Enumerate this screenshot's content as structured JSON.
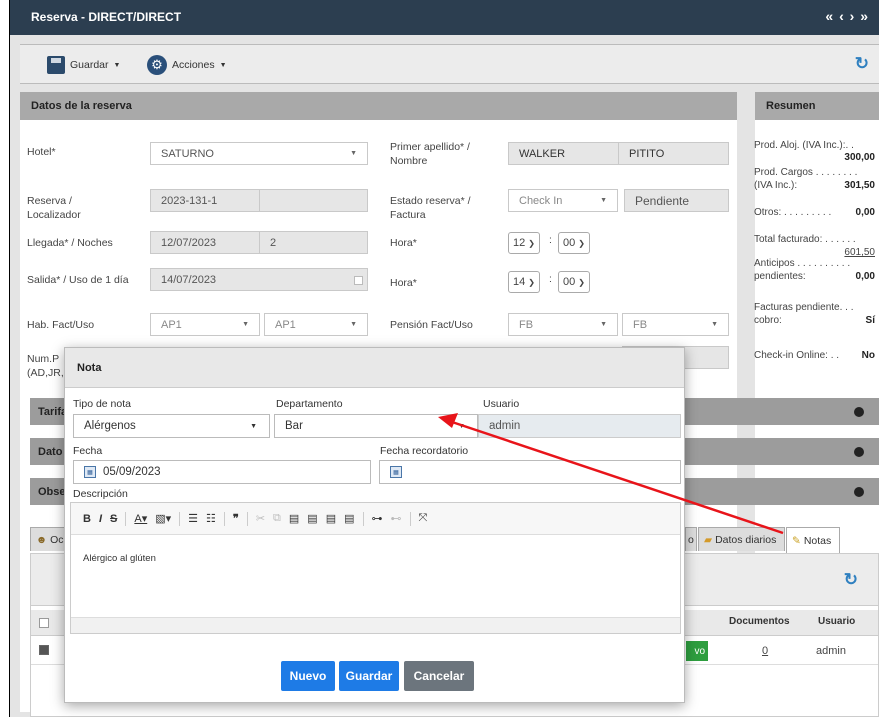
{
  "window": {
    "title": "Reserva - DIRECT/DIRECT",
    "pager": "« ‹ › »"
  },
  "toolbar": {
    "save_label": "Guardar",
    "actions_label": "Acciones"
  },
  "booking": {
    "section_title": "Datos de la reserva",
    "hotel_label": "Hotel*",
    "hotel_value": "SATURNO",
    "surname_label": "Primer apellido* / Nombre",
    "surname_value": "WALKER",
    "name_value": "PITITO",
    "reserva_label": "Reserva / Localizador",
    "reserva_value": "2023-131-1",
    "estado_label": "Estado reserva* / Factura",
    "estado_value": "Check In",
    "factura_value": "Pendiente",
    "llegada_label": "Llegada* / Noches",
    "llegada_value": "12/07/2023",
    "noches_value": "2",
    "hora1_label": "Hora*",
    "hora1_h": "12",
    "hora1_m": "00",
    "salida_label": "Salida* / Uso de 1 día",
    "salida_value": "14/07/2023",
    "hora2_label": "Hora*",
    "hora2_h": "14",
    "hora2_m": "00",
    "hab_label": "Hab. Fact/Uso",
    "hab_fact": "AP1",
    "hab_uso": "AP1",
    "pension_label": "Pensión Fact/Uso",
    "pension_fact": "FB",
    "pension_uso": "FB",
    "num_label": "Num.P (AD,JR,"
  },
  "sections": {
    "tarifa": "Tarifa",
    "datos": "Dato",
    "obs": "Obse"
  },
  "resumen": {
    "title": "Resumen",
    "prod_aloj_label": "Prod. Aloj. (IVA Inc.):. .",
    "prod_aloj_value": "300,00",
    "prod_cargos_label": "Prod. Cargos . . . . . . . .",
    "prod_cargos_label2": "(IVA Inc.):",
    "prod_cargos_value": "301,50",
    "otros_label": "Otros: . . . . . . . . .",
    "otros_value": "0,00",
    "total_label": "Total facturado: . . . . . .",
    "total_value": "601,50",
    "anticipos_label": "Anticipos . . . . . . . . . .",
    "anticipos_label2": "pendientes:",
    "anticipos_value": "0,00",
    "facturas_label": "Facturas pendiente. . .",
    "facturas_label2": "cobro:",
    "facturas_value": "Sí",
    "checkin_label": "Check-in Online: . .",
    "checkin_value": "No"
  },
  "tabs": {
    "first": "Oc",
    "datos_diarios": "Datos diarios",
    "notas": "Notas",
    "partial": "o"
  },
  "table": {
    "col_documentos": "Documentos",
    "col_usuario": "Usuario",
    "row_documentos": "0",
    "row_usuario": "admin",
    "row_badge": "vo"
  },
  "modal": {
    "title": "Nota",
    "tipo_label": "Tipo de nota",
    "tipo_value": "Alérgenos",
    "depto_label": "Departamento",
    "depto_value": "Bar",
    "usuario_label": "Usuario",
    "usuario_value": "admin",
    "fecha_label": "Fecha",
    "fecha_value": "05/09/2023",
    "recordatorio_label": "Fecha recordatorio",
    "recordatorio_value": "",
    "descripcion_label": "Descripción",
    "descripcion_value": "Alérgico al glúten",
    "btn_nuevo": "Nuevo",
    "btn_guardar": "Guardar",
    "btn_cancelar": "Cancelar"
  },
  "colors": {
    "titlebar": "#2c3e50",
    "primary": "#1e7be6",
    "cancel": "#6c757d",
    "arrow": "#e8141a",
    "badge": "#2e9e3f"
  }
}
